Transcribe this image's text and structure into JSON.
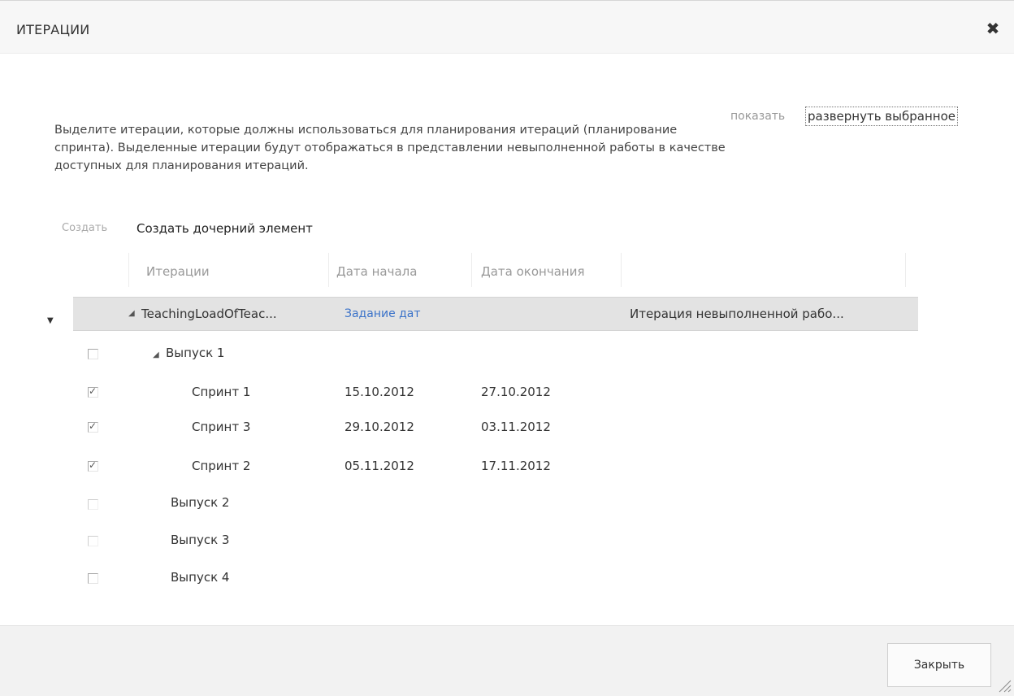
{
  "dialog": {
    "title": "ИТЕРАЦИИ",
    "close_icon": "close-icon"
  },
  "view": {
    "show_label": "показать",
    "expand_selected": "развернуть выбранное"
  },
  "description": "Выделите итерации, которые должны использоваться для планирования итераций (планирование спринта). Выделенные итерации будут отображаться в представлении невыполненной работы в качестве доступных для планирования итераций.",
  "toolbar": {
    "create": "Создать",
    "create_child": "Создать дочерний элемент"
  },
  "grid": {
    "columns": [
      "Итерации",
      "Дата начала",
      "Дата окончания"
    ],
    "root": {
      "name": "TeachingLoadOfTeac...",
      "start": "Задание дат",
      "backlog": "Итерация невыполненной рабо..."
    },
    "rows": [
      {
        "name": "Выпуск 1",
        "start": "",
        "end": "",
        "checked": false
      },
      {
        "name": "Спринт 1",
        "start": "15.10.2012",
        "end": "27.10.2012",
        "checked": true
      },
      {
        "name": "Спринт 3",
        "start": "29.10.2012",
        "end": "03.11.2012",
        "checked": true
      },
      {
        "name": "Спринт 2",
        "start": "05.11.2012",
        "end": "17.11.2012",
        "checked": true
      },
      {
        "name": "Выпуск 2",
        "start": "",
        "end": "",
        "checked": false
      },
      {
        "name": "Выпуск 3",
        "start": "",
        "end": "",
        "checked": false
      },
      {
        "name": "Выпуск 4",
        "start": "",
        "end": "",
        "checked": false
      }
    ]
  },
  "footer": {
    "close_button": "Закрыть"
  }
}
